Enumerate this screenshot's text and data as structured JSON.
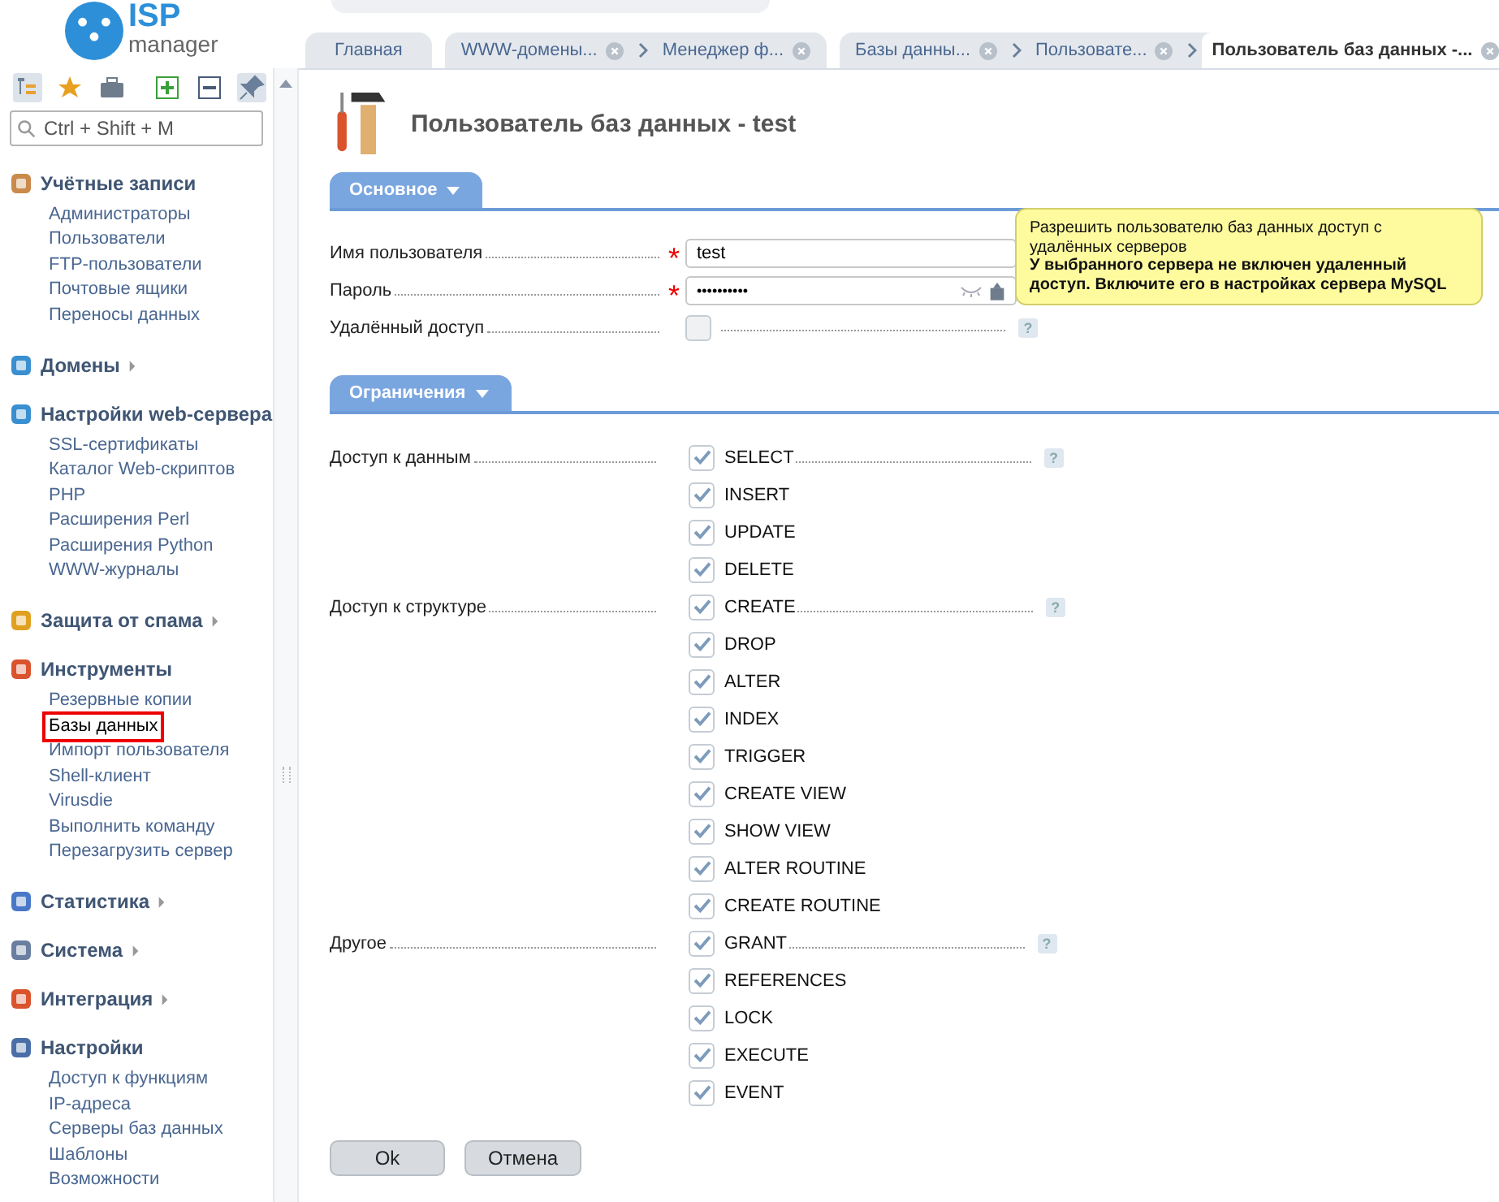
{
  "logo": {
    "line1": "ISP",
    "line2": "manager"
  },
  "sidebar": {
    "search": {
      "placeholder": "Ctrl + Shift + M"
    },
    "sections": [
      {
        "kind": "accounts",
        "title": "Учётные записи",
        "expanded": true,
        "items": [
          {
            "label": "Администраторы",
            "selected": false
          },
          {
            "label": "Пользователи",
            "selected": false
          },
          {
            "label": "FTP-пользователи",
            "selected": false
          },
          {
            "label": "Почтовые ящики",
            "selected": false
          },
          {
            "label": "Переносы данных",
            "selected": false
          }
        ]
      },
      {
        "kind": "domains",
        "title": "Домены",
        "expanded": false
      },
      {
        "kind": "web",
        "title": "Настройки web-сервера",
        "expanded": true,
        "items": [
          {
            "label": "SSL-сертификаты",
            "selected": false
          },
          {
            "label": "Каталог Web-скриптов",
            "selected": false
          },
          {
            "label": "PHP",
            "selected": false
          },
          {
            "label": "Расширения Perl",
            "selected": false
          },
          {
            "label": "Расширения Python",
            "selected": false
          },
          {
            "label": "WWW-журналы",
            "selected": false
          }
        ]
      },
      {
        "kind": "spam",
        "title": "Защита от спама",
        "expanded": false
      },
      {
        "kind": "tools",
        "title": "Инструменты",
        "expanded": true,
        "items": [
          {
            "label": "Резервные копии",
            "selected": false
          },
          {
            "label": "Базы данных",
            "selected": true
          },
          {
            "label": "Импорт пользователя",
            "selected": false
          },
          {
            "label": "Shell-клиент",
            "selected": false
          },
          {
            "label": "Virusdie",
            "selected": false
          },
          {
            "label": "Выполнить команду",
            "selected": false
          },
          {
            "label": "Перезагрузить сервер",
            "selected": false
          }
        ]
      },
      {
        "kind": "stats",
        "title": "Статистика",
        "expanded": false
      },
      {
        "kind": "system",
        "title": "Система",
        "expanded": false
      },
      {
        "kind": "integration",
        "title": "Интеграция",
        "expanded": false
      },
      {
        "kind": "settings",
        "title": "Настройки",
        "expanded": true,
        "items": [
          {
            "label": "Доступ к функциям",
            "selected": false
          },
          {
            "label": "IP-адреса",
            "selected": false
          },
          {
            "label": "Серверы баз данных",
            "selected": false
          },
          {
            "label": "Шаблоны",
            "selected": false
          },
          {
            "label": "Возможности",
            "selected": false
          }
        ]
      }
    ]
  },
  "tab_groups": [
    [
      {
        "label": "Главная",
        "selected": false,
        "closable": false
      }
    ],
    [
      {
        "label": "WWW-домены...",
        "selected": false,
        "closable": true
      },
      {
        "label": "Менеджер ф...",
        "selected": false,
        "closable": true
      }
    ],
    [
      {
        "label": "Базы данны...",
        "selected": false,
        "closable": true
      },
      {
        "label": "Пользовате...",
        "selected": false,
        "closable": true
      },
      {
        "label": "Пользователь баз данных -...",
        "selected": true,
        "closable": true
      }
    ]
  ],
  "page_title": "Пользователь баз данных - test",
  "main_section": {
    "title": "Основное",
    "fields": [
      {
        "kind": "text",
        "label": "Имя пользователя",
        "required_mark": "*",
        "value": "test"
      },
      {
        "kind": "password",
        "label": "Пароль",
        "required_mark": "*",
        "value": "••••••••••"
      },
      {
        "kind": "checkbox",
        "label": "Удалённый доступ",
        "checked": false,
        "help": "?"
      }
    ],
    "tooltip": {
      "text": "Разрешить пользователю баз данных доступ с удалённых серверов",
      "warning": "У выбранного сервера не включен удаленный доступ. Включите его в настройках сервера MySQL"
    }
  },
  "limits_section": {
    "title": "Ограничения",
    "groups": [
      {
        "label": "Доступ к данным",
        "help": "?",
        "options": [
          {
            "label": "SELECT",
            "checked": true
          },
          {
            "label": "INSERT",
            "checked": true
          },
          {
            "label": "UPDATE",
            "checked": true
          },
          {
            "label": "DELETE",
            "checked": true
          }
        ]
      },
      {
        "label": "Доступ к структуре",
        "help": "?",
        "options": [
          {
            "label": "CREATE",
            "checked": true
          },
          {
            "label": "DROP",
            "checked": true
          },
          {
            "label": "ALTER",
            "checked": true
          },
          {
            "label": "INDEX",
            "checked": true
          },
          {
            "label": "TRIGGER",
            "checked": true
          },
          {
            "label": "CREATE VIEW",
            "checked": true
          },
          {
            "label": "SHOW VIEW",
            "checked": true
          },
          {
            "label": "ALTER ROUTINE",
            "checked": true
          },
          {
            "label": "CREATE ROUTINE",
            "checked": true
          }
        ]
      },
      {
        "label": "Другое",
        "help": "?",
        "options": [
          {
            "label": "GRANT",
            "checked": true
          },
          {
            "label": "REFERENCES",
            "checked": true
          },
          {
            "label": "LOCK",
            "checked": true
          },
          {
            "label": "EXECUTE",
            "checked": true
          },
          {
            "label": "EVENT",
            "checked": true
          }
        ]
      }
    ]
  },
  "buttons": [
    {
      "label": "Ok"
    },
    {
      "label": "Отмена"
    }
  ]
}
